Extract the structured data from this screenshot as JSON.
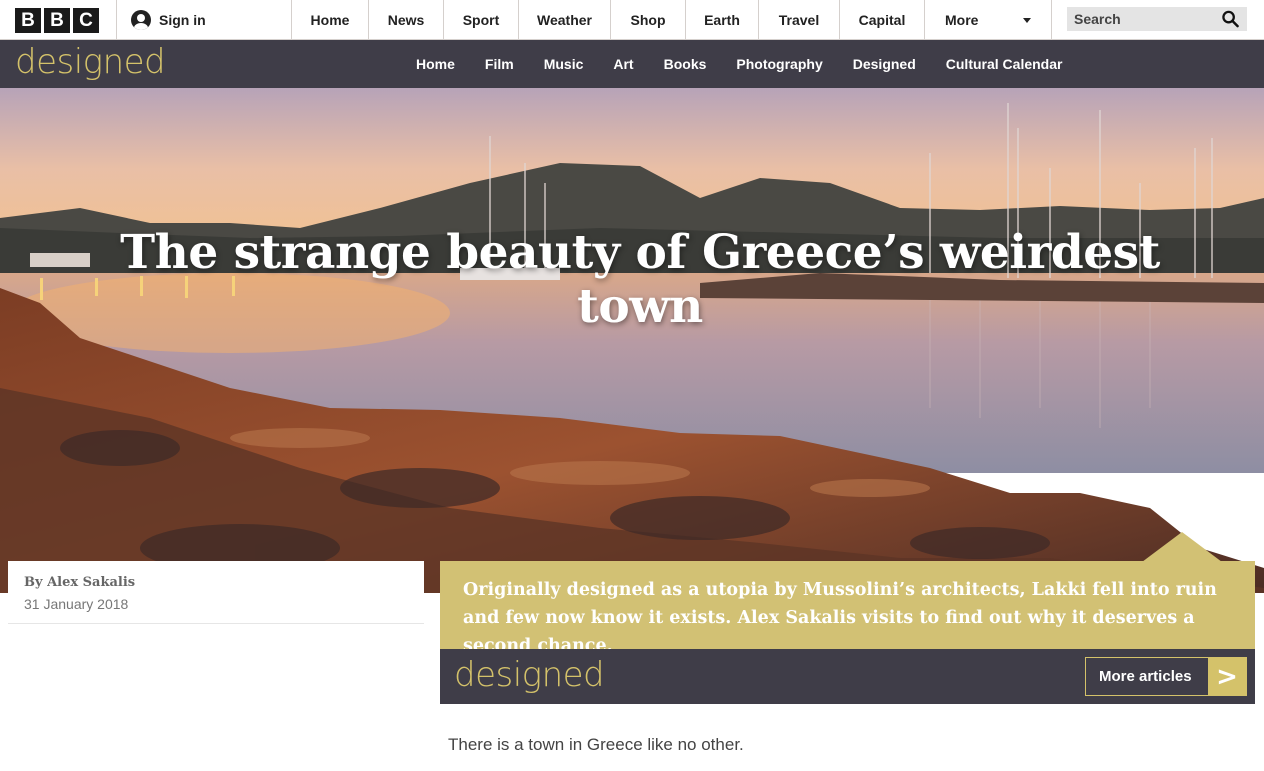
{
  "bbc": {
    "logo_letters": [
      "B",
      "B",
      "C"
    ],
    "sign_in": "Sign in",
    "nav": [
      "Home",
      "News",
      "Sport",
      "Weather",
      "Shop",
      "Earth",
      "Travel",
      "Capital"
    ],
    "more": "More",
    "search_placeholder": "Search"
  },
  "designed_bar": {
    "logo": "designed",
    "nav": [
      "Home",
      "Film",
      "Music",
      "Art",
      "Books",
      "Photography",
      "Designed",
      "Cultural Calendar"
    ]
  },
  "article": {
    "headline": "The strange beauty of Greece’s weirdest town",
    "author": "By Alex Sakalis",
    "date": "31 January 2018",
    "summary": "Originally designed as a utopia by Mussolini’s architects, Lakki fell into ruin and few now know it exists. Alex Sakalis visits to find out why it deserves a second chance.",
    "first_paragraph": "There is a town in Greece like no other."
  },
  "promo": {
    "logo": "designed",
    "button": "More articles",
    "button_arrow": ">"
  },
  "colors": {
    "dark_bar": "#3f3d48",
    "gold": "#d4c26a",
    "summary_bg": "#d2c174"
  }
}
